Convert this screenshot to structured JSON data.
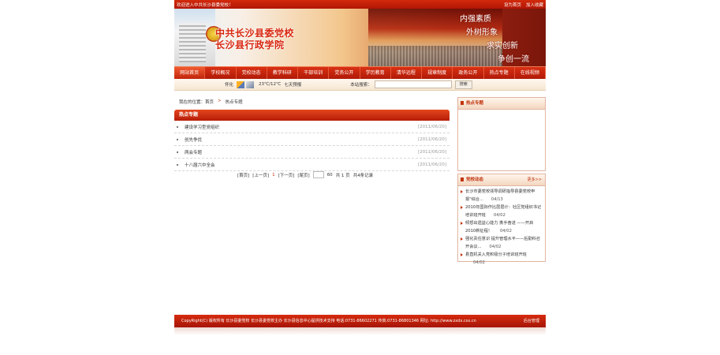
{
  "topbar": {
    "welcome": "欢迎进入中共长沙县委党校！",
    "set_home": "设为首页",
    "add_fav": "加入收藏"
  },
  "banner": {
    "title1": "中共长沙县委党校",
    "title2": "长沙县行政学院",
    "slogans": [
      "内强素质",
      "外树形象",
      "求实创新",
      "争创一流"
    ]
  },
  "nav": {
    "items": [
      "网站首页",
      "学校概况",
      "党校动态",
      "教学科研",
      "干部培训",
      "党务公开",
      "学历教育",
      "清华远程",
      "规章制度",
      "政务公开",
      "热点专题",
      "在线视频"
    ]
  },
  "weather": {
    "city": "怀化",
    "temp": "23℃/12℃",
    "forecast": "七天预报"
  },
  "search": {
    "label": "本站搜索：",
    "button": "搜索"
  },
  "breadcrumb": {
    "prefix": "我在的位置：首页",
    "sep": ">",
    "current": "热点专题"
  },
  "hot_topics": {
    "header": "热点专题",
    "rows": [
      {
        "title": "建设学习型党组织",
        "date": "[2011/06/20]"
      },
      {
        "title": "创先争优",
        "date": "[2011/06/20]"
      },
      {
        "title": "两会专题",
        "date": "[2011/06/20]"
      },
      {
        "title": "十八届六中全会",
        "date": "[2011/06/20]"
      }
    ]
  },
  "pager": {
    "first": "[首页]",
    "prev": "[上一页]",
    "current": "1",
    "next": "[下一页]",
    "last": "[尾页]",
    "count": "60",
    "pages": "共 1 页",
    "records": "共4条记录"
  },
  "sidebar": {
    "hot_header": "热点专题",
    "news_header": "党校动态",
    "more": "更多>>",
    "news": [
      {
        "title": "长沙市委党校领导调研指导县委党校申报\"综合...",
        "date": "04/13"
      },
      {
        "title": "2010年国际作比层层计：社区党组织书记培训班开班",
        "date": "04/02"
      },
      {
        "title": "倾怒出遗益心能力 携手奋进 ——开启2010新征程！",
        "date": "04/02"
      },
      {
        "title": "强化责任意识 提升管理水平——后勤科召开会议...",
        "date": "04/02"
      },
      {
        "title": "县直机关入党积极分子培训班开班",
        "date": "04/02"
      }
    ]
  },
  "footer": {
    "copyright": "CopyRight(C) 版权所有 长沙县委党校 长沙县委党校主办 长沙县信息中心提供技术支持 电话:0731-86602271 传真:0731-86801346 网址: http://www.zxdx.csx.cn",
    "admin": "后台管理"
  },
  "colors": {
    "brand_red": "#c0330e",
    "nav_red": "#b01a07"
  }
}
